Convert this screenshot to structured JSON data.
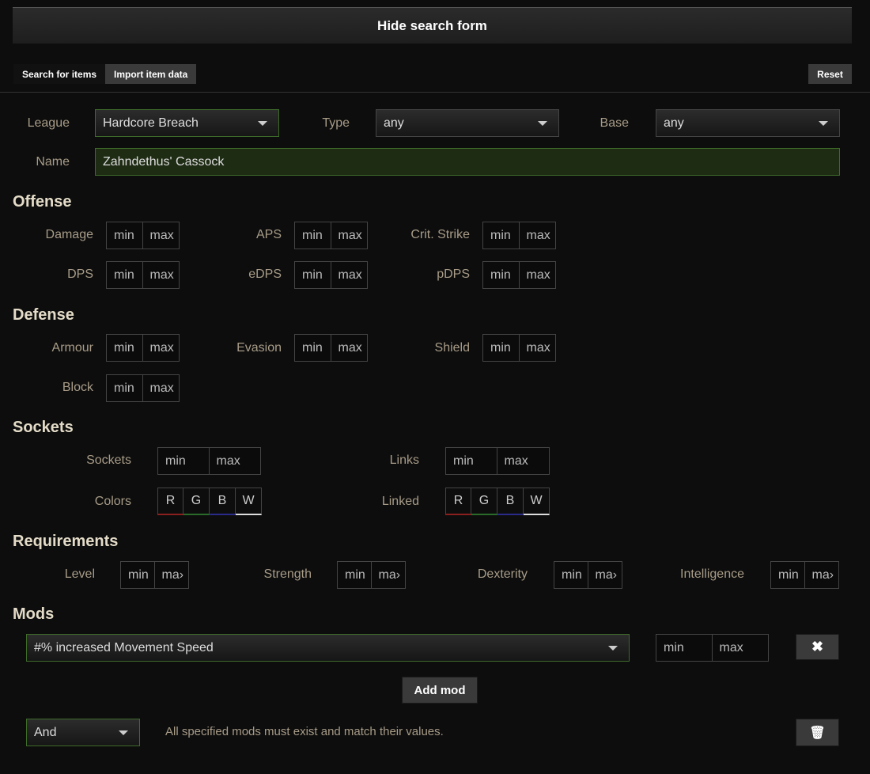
{
  "header": {
    "toggle_label": "Hide search form"
  },
  "tabs": [
    {
      "label": "Search for items"
    },
    {
      "label": "Import item data"
    }
  ],
  "reset_label": "Reset",
  "general": {
    "league_label": "League",
    "league_value": "Hardcore Breach",
    "type_label": "Type",
    "type_value": "any",
    "base_label": "Base",
    "base_value": "any",
    "name_label": "Name",
    "name_value": "Zahndethus' Cassock"
  },
  "placeholders": {
    "min": "min",
    "max": "max"
  },
  "offense": {
    "heading": "Offense",
    "damage": "Damage",
    "aps": "APS",
    "crit": "Crit. Strike",
    "dps": "DPS",
    "edps": "eDPS",
    "pdps": "pDPS"
  },
  "defense": {
    "heading": "Defense",
    "armour": "Armour",
    "evasion": "Evasion",
    "shield": "Shield",
    "block": "Block"
  },
  "sockets": {
    "heading": "Sockets",
    "sockets": "Sockets",
    "links": "Links",
    "colors": "Colors",
    "linked": "Linked",
    "letters": {
      "r": "R",
      "g": "G",
      "b": "B",
      "w": "W"
    }
  },
  "requirements": {
    "heading": "Requirements",
    "level": "Level",
    "strength": "Strength",
    "dexterity": "Dexterity",
    "intelligence": "Intelligence",
    "max_truncated": "ma›"
  },
  "mods": {
    "heading": "Mods",
    "mod_value": "#% increased Movement Speed",
    "remove_symbol": "✖",
    "add_label": "Add mod",
    "group_value": "And",
    "group_hint": "All specified mods must exist and match their values.",
    "delete_symbol": "🗑"
  }
}
